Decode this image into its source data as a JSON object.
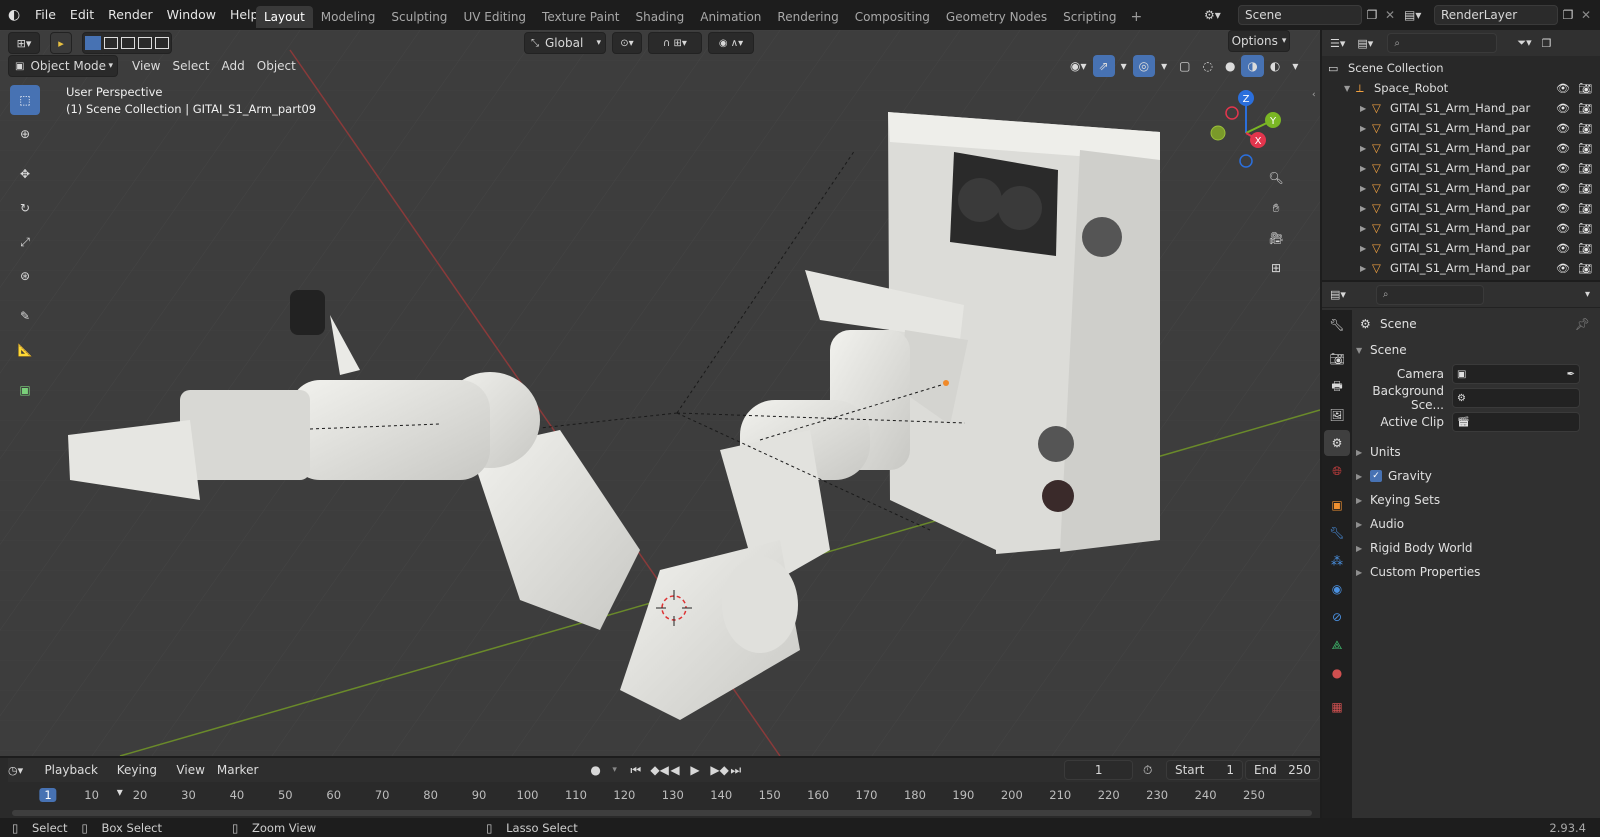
{
  "menu": [
    "File",
    "Edit",
    "Render",
    "Window",
    "Help"
  ],
  "workspaces": [
    "Layout",
    "Modeling",
    "Sculpting",
    "UV Editing",
    "Texture Paint",
    "Shading",
    "Animation",
    "Rendering",
    "Compositing",
    "Geometry Nodes",
    "Scripting"
  ],
  "scene_field": "Scene",
  "view_layer_field": "RenderLayer",
  "viewport": {
    "orientation": "Global",
    "options_label": "Options",
    "mode": "Object Mode",
    "header_menus": [
      "View",
      "Select",
      "Add",
      "Object"
    ],
    "overlay_line1": "User Perspective",
    "overlay_line2": "(1) Scene Collection | GITAI_S1_Arm_part09",
    "gizmo": {
      "z": "Z",
      "y": "Y",
      "x": "X"
    }
  },
  "outliner": {
    "root": "Scene Collection",
    "collection": "Space_Robot",
    "items": [
      "GITAI_S1_Arm_Hand_par",
      "GITAI_S1_Arm_Hand_par",
      "GITAI_S1_Arm_Hand_par",
      "GITAI_S1_Arm_Hand_par",
      "GITAI_S1_Arm_Hand_par",
      "GITAI_S1_Arm_Hand_par",
      "GITAI_S1_Arm_Hand_par",
      "GITAI_S1_Arm_Hand_par",
      "GITAI_S1_Arm_Hand_par"
    ]
  },
  "properties": {
    "context": "Scene",
    "section": "Scene",
    "camera_label": "Camera",
    "background_label": "Background Sce...",
    "clip_label": "Active Clip",
    "panels": [
      "Units",
      "Gravity",
      "Keying Sets",
      "Audio",
      "Rigid Body World",
      "Custom Properties"
    ],
    "gravity_checked": true
  },
  "timeline": {
    "menus": [
      "Playback",
      "Keying",
      "View",
      "Marker"
    ],
    "current_frame": "1",
    "start_label": "Start",
    "start_value": "1",
    "end_label": "End",
    "end_value": "250",
    "ticks": [
      "1",
      "10",
      "20",
      "30",
      "40",
      "50",
      "60",
      "70",
      "80",
      "90",
      "100",
      "110",
      "120",
      "130",
      "140",
      "150",
      "160",
      "170",
      "180",
      "190",
      "200",
      "210",
      "220",
      "230",
      "240",
      "250"
    ]
  },
  "statusbar": {
    "select": "Select",
    "box_select": "Box Select",
    "zoom_view": "Zoom View",
    "lasso_select": "Lasso Select",
    "version": "2.93.4"
  },
  "colors": {
    "accent": "#4772b3",
    "viewport_bg": "#3d3d3d",
    "axis_red": "#8a3a3a",
    "axis_green": "#6a8a2a",
    "gizmo_z": "#2b6fdc",
    "gizmo_y": "#7ab624",
    "gizmo_x": "#e3354d"
  }
}
